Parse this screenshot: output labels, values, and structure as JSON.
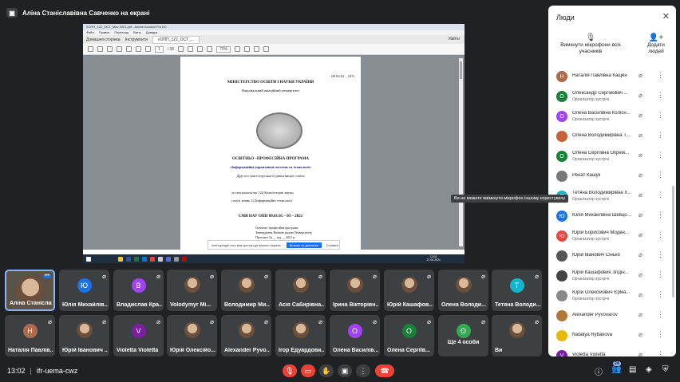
{
  "presenter": {
    "label": "Аліна Станіславівна Савченко на екрані"
  },
  "shared_screen": {
    "window_title": "≡ОПП_122_ОСТ_Мас 2021.pdf - Adobe Acrobat Pro DC",
    "menu": [
      "Файл",
      "Правка",
      "Перегляд",
      "Вікно",
      "Довідка"
    ],
    "tabs": [
      "Домашня сторінка",
      "Інструменти",
      "≡ОПП_122_ОСТ_..."
    ],
    "sign_in": "Увійти",
    "page_current": "1",
    "page_total": "/ 36",
    "zoom": "70%",
    "doc": {
      "code": "(Ф 03.02 – 107)",
      "ministry": "МІНІСТЕРСТВО ОСВІТИ І НАУКИ УКРАЇНИ",
      "university": "Національний авіаційний університет",
      "program_title": "ОСВІТНЬО –ПРОФЕСІЙНА ПРОГРАМА",
      "program_name": "«Інформаційні управляючі системи та технології»",
      "level": "Другого (магістерського) рівня вищої освіти",
      "specialty": "за спеціальністю 122 Комп'ютерні науки",
      "field": "галузі знань 12 Інформаційні технології",
      "smya": "СМЯ НАУ ОПП 09.01.05 – 03 – 2021",
      "approved": "Освітньо-професійна програма",
      "approved2": "Затверджена Вченою радою Університету",
      "approved3": "Протокол № __ від __ 2021 р."
    },
    "popup_text": "meet.google.com має доступ до вашого екрана.",
    "popup_stop": "Більше не ділитися",
    "popup_hide": "Сховати",
    "clock_time": "13:01",
    "clock_date": "27.04.2021",
    "lang": "ENG"
  },
  "tiles": [
    {
      "name": "Аліна Станіслав...",
      "self": true
    },
    {
      "name": "Юлія Михайлів...",
      "initial": "Ю",
      "color": "#1a73e8"
    },
    {
      "name": "Владислав Кра...",
      "initial": "В",
      "color": "#a142f4"
    },
    {
      "name": "Volodymyr Mi...",
      "photo": true
    },
    {
      "name": "Володимир Ми...",
      "photo": true
    },
    {
      "name": "Асія Сабирівна...",
      "photo": true
    },
    {
      "name": "Ірина Вікторівн...",
      "photo": true
    },
    {
      "name": "Юрій Кашафов...",
      "photo": true
    },
    {
      "name": "Олена Володи...",
      "photo": true
    },
    {
      "name": "Тетяна Володи...",
      "initial": "Т",
      "color": "#12b5cb"
    },
    {
      "name": "Наталія Павлів...",
      "initial": "Н",
      "color": "#ad6b4c"
    },
    {
      "name": "Юрій Іванович ...",
      "photo": true
    },
    {
      "name": "Violetta Violetta",
      "initial": "V",
      "color": "#7b1fa2"
    },
    {
      "name": "Юрій Олексійо...",
      "photo": true
    },
    {
      "name": "Alexander Pyvo...",
      "photo": true
    },
    {
      "name": "Ігор Едуардови...",
      "photo": true
    },
    {
      "name": "Олена Василів...",
      "initial": "О",
      "color": "#a142f4"
    },
    {
      "name": "Олена Сергіїв...",
      "initial": "О",
      "color": "#188038"
    },
    {
      "name": "Ще 4 особи",
      "more": true,
      "initial": "О",
      "color": "#34a853"
    },
    {
      "name": "Ви",
      "photo": true
    }
  ],
  "bottom": {
    "time": "13:02",
    "meeting_code": "ifr-uema-cwz",
    "participants_count": "24"
  },
  "panel": {
    "title": "Люди",
    "mute_all": "Вимкнути мікрофони всіх учасників",
    "add_people": "Додати людей",
    "tooltip": "Ви не можете ввімкнути мікрофон іншому користувачу",
    "people": [
      {
        "name": "Наталія Павлівна Кащен",
        "initial": "Н",
        "color": "#ad6b4c",
        "role": ""
      },
      {
        "name": "Олександр Сергійович ...",
        "initial": "О",
        "color": "#188038",
        "role": "Організатор зустрічі"
      },
      {
        "name": "Олена Василівна Колісн...",
        "initial": "О",
        "color": "#a142f4",
        "role": "Організатор зустрічі"
      },
      {
        "name": "Олена Володимирівна Т...",
        "initial": "",
        "color": "#c5623a",
        "role": ""
      },
      {
        "name": "Олена Сергіївна Охрем...",
        "initial": "О",
        "color": "#188038",
        "role": "Організатор зустрічі"
      },
      {
        "name": "Ренат Кашук",
        "initial": "",
        "color": "#777777",
        "role": ""
      },
      {
        "name": "Тетяна Володимирівна Х...",
        "initial": "Т",
        "color": "#12b5cb",
        "role": "Організатор зустрічі"
      },
      {
        "name": "Юлія Михайлівна Шевцо...",
        "initial": "Ю",
        "color": "#1a73e8",
        "role": ""
      },
      {
        "name": "Юрій Борисович Моден...",
        "initial": "Ю",
        "color": "#e8453c",
        "role": "Організатор зустрічі"
      },
      {
        "name": "Юрій Іванович Сінько",
        "initial": "",
        "color": "#555555",
        "role": ""
      },
      {
        "name": "Юрій Кашафович Згідін...",
        "initial": "",
        "color": "#444444",
        "role": "Організатор зустрічі"
      },
      {
        "name": "Юрій Олексійович Єрма...",
        "initial": "",
        "color": "#888888",
        "role": "Організатор зустрічі"
      },
      {
        "name": "Alexander Pyvovarov",
        "initial": "",
        "color": "#b0763a",
        "role": ""
      },
      {
        "name": "Nataliya Rybakova",
        "initial": "",
        "color": "#e6b800",
        "role": ""
      },
      {
        "name": "Violetta Violetta",
        "initial": "V",
        "color": "#7b1fa2",
        "role": ""
      }
    ]
  }
}
